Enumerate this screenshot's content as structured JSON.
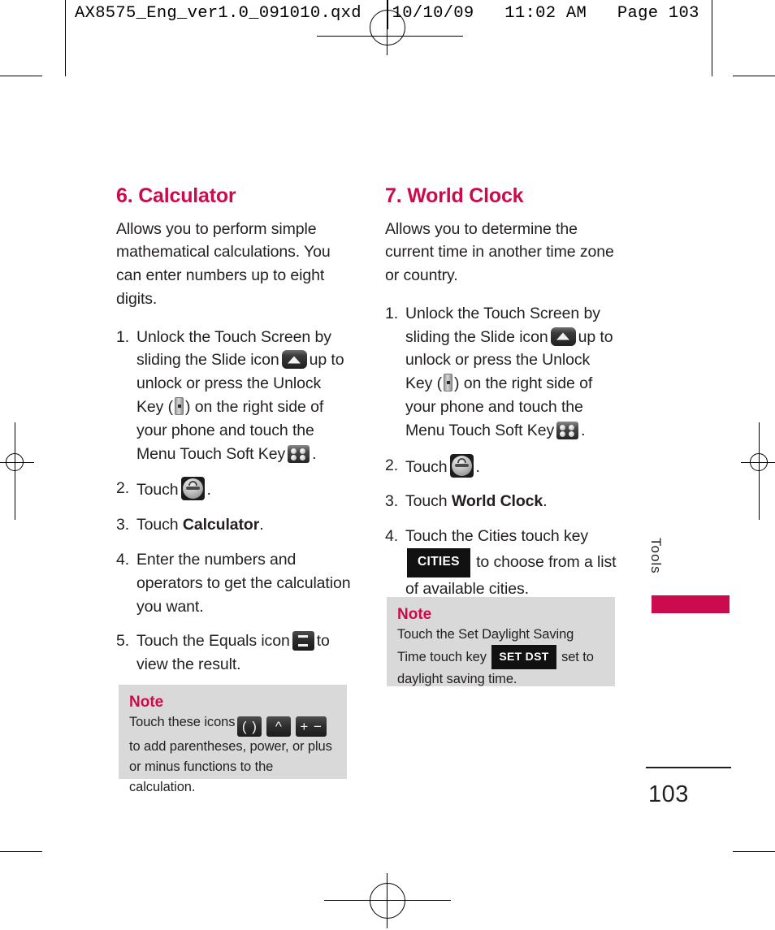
{
  "print_header": {
    "text": "AX8575_Eng_ver1.0_091010.qxd   10/10/09   11:02 AM   Page 103"
  },
  "side_tab": {
    "label": "Tools"
  },
  "folio": {
    "page_number": "103"
  },
  "colors": {
    "accent": "#cc0b4f",
    "note_background": "#d9d9d9",
    "text": "#231f20",
    "key_black": "#111111"
  },
  "columns": {
    "left": {
      "title": "6. Calculator",
      "intro": "Allows you to perform simple mathematical calculations. You can enter numbers up to eight digits.",
      "steps": [
        {
          "num": "1.",
          "part1": "Unlock the Touch Screen by sliding the Slide icon",
          "part2": "up to unlock or press the Unlock Key (",
          "part3": ") on the right side of your phone and touch the Menu Touch Soft Key",
          "part4": "."
        },
        {
          "num": "2.",
          "part1": "Touch",
          "part2": "."
        },
        {
          "num": "3.",
          "part1": "Touch",
          "bold": "Calculator",
          "part2": "."
        },
        {
          "num": "4.",
          "part1": "Enter the numbers and operators to get the calculation you want."
        },
        {
          "num": "5.",
          "part1": "Touch the Equals icon",
          "part2": "to view the result."
        }
      ],
      "note": {
        "title": "Note",
        "part1": "Touch these icons",
        "key1": "( )",
        "key2": "^",
        "key3": "+ −",
        "part2": "to add parentheses, power, or plus or minus functions to the calculation."
      }
    },
    "right": {
      "title": "7. World Clock",
      "intro": "Allows you to determine the current time in another time zone or country.",
      "steps": [
        {
          "num": "1.",
          "part1": "Unlock the Touch Screen by sliding the Slide icon",
          "part2": "up to unlock or press the Unlock Key (",
          "part3": ") on the right side of your phone and touch the Menu Touch Soft Key",
          "part4": "."
        },
        {
          "num": "2.",
          "part1": "Touch",
          "part2": "."
        },
        {
          "num": "3.",
          "part1": "Touch",
          "bold": "World Clock",
          "part2": "."
        },
        {
          "num": "4.",
          "part1": "Touch the Cities touch key",
          "key": "CITIES",
          "part2": "to choose from a list of available cities."
        }
      ],
      "note": {
        "title": "Note",
        "part1": "Touch the Set Daylight Saving Time touch key",
        "key": "SET DST",
        "part2": "set to daylight saving time."
      }
    }
  },
  "icons": {
    "slide": "slide-up-icon",
    "unlock": "unlock-key-icon",
    "menu": "menu-soft-key-icon",
    "tools": "tools-icon",
    "equals": "equals-key-icon"
  }
}
